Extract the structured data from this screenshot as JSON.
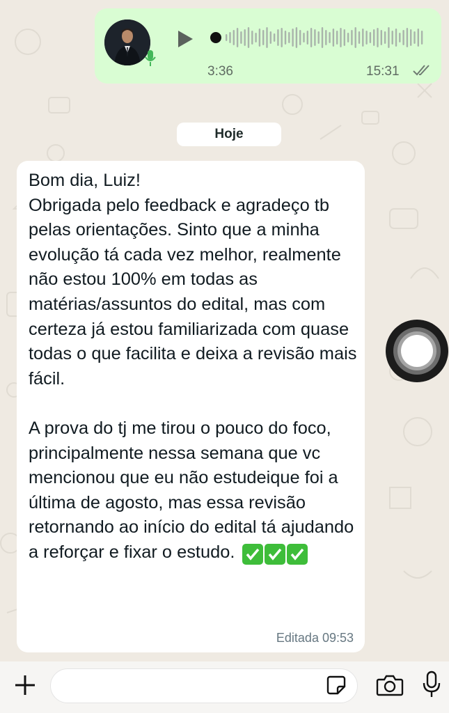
{
  "voice_message": {
    "duration": "3:36",
    "time": "15:31"
  },
  "date_separator": "Hoje",
  "message": {
    "text": "Bom dia, Luiz!\nObrigada pelo feedback e agradeço tb pelas orientações. Sinto que a minha evolução tá cada vez melhor, realmente não estou 100% em todas as matérias/assuntos do edital, mas com certeza já estou familiarizada com quase todas o que facilita e deixa a revisão mais fácil.\n\nA prova do tj me tirou o pouco do foco, principalmente nessa semana que vc mencionou que eu não estudeique foi a última de agosto, mas essa revisão retornando ao início do edital tá ajudando a reforçar e fixar o estudo.",
    "emoji": "✅✅✅",
    "edited_label": "Editada 09:53"
  },
  "colors": {
    "outgoing_bubble": "#d9fdd3",
    "chat_background": "#efeae2",
    "emoji_check": "#3ebd3a"
  },
  "icons": [
    "play-icon",
    "mic-icon",
    "double-check-icon",
    "plus-icon",
    "sticker-icon",
    "camera-icon",
    "microphone-icon"
  ]
}
